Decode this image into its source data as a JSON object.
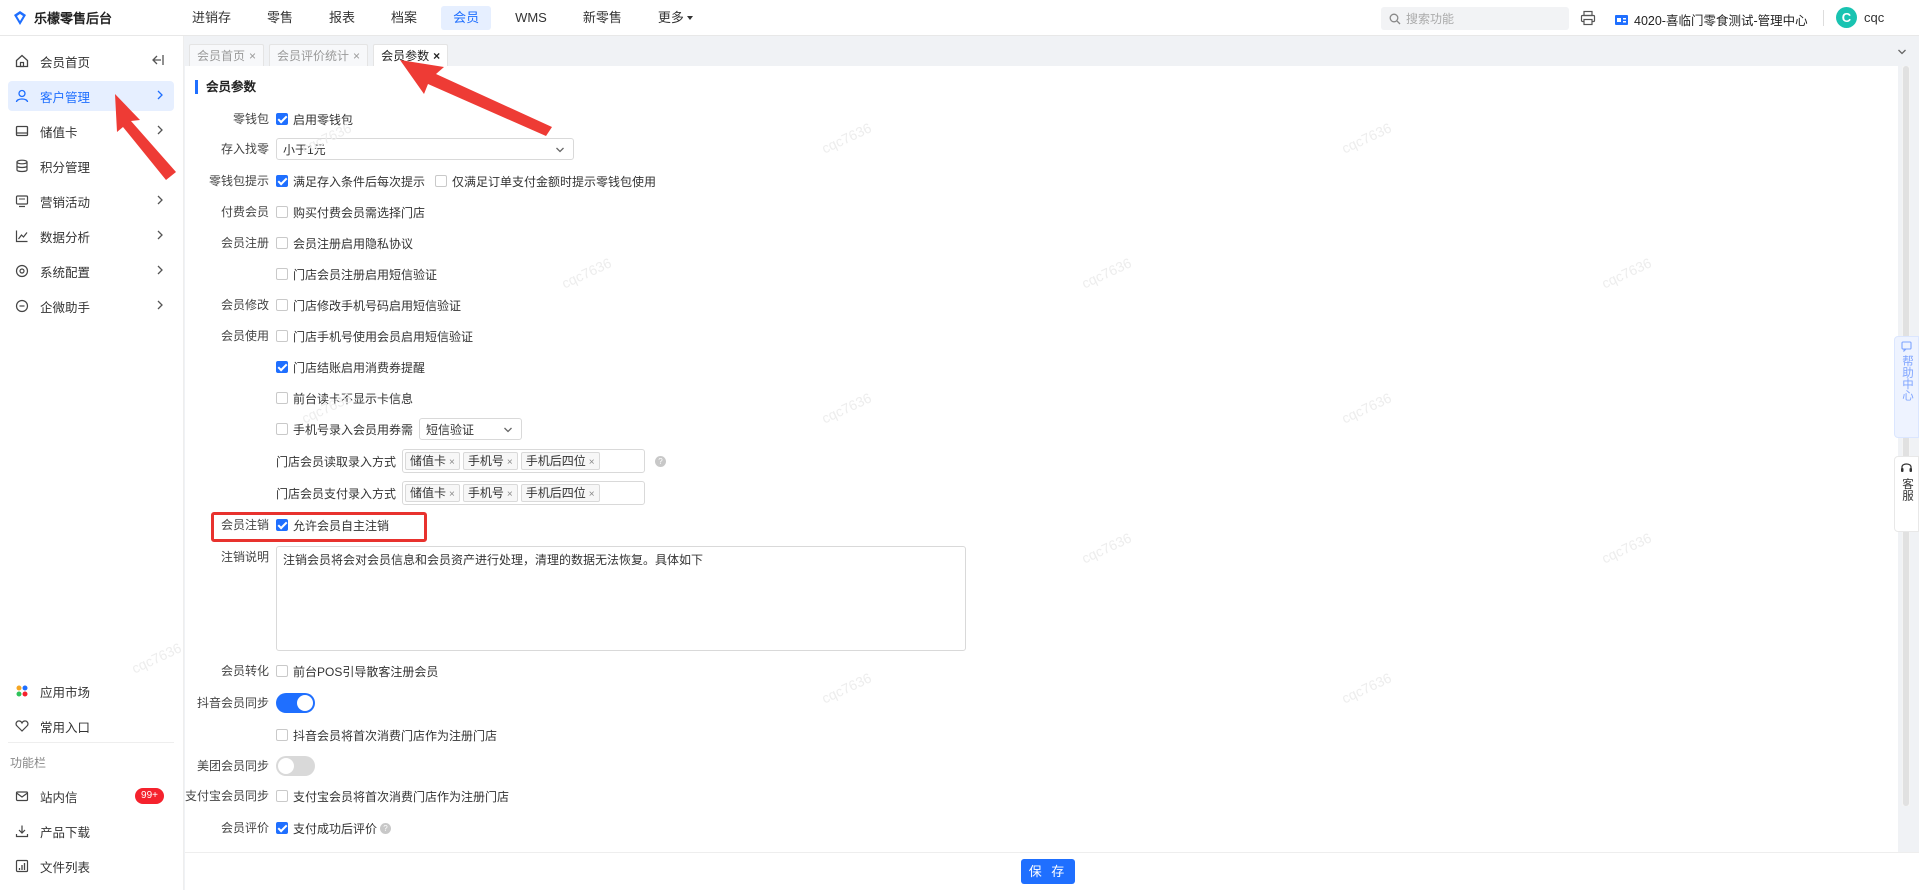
{
  "app": {
    "title": "乐檬零售后台"
  },
  "topnav": [
    "进销存",
    "零售",
    "报表",
    "档案",
    "会员",
    "WMS",
    "新零售",
    "更多"
  ],
  "topnav_active": "会员",
  "search": {
    "placeholder": "搜索功能"
  },
  "store": "4020-喜临门零食测试-管理中心",
  "user": {
    "avatar_letter": "C",
    "name": "cqc"
  },
  "sidebar": {
    "items": [
      {
        "label": "会员首页",
        "icon": "home-icon"
      },
      {
        "label": "客户管理",
        "icon": "user-icon"
      },
      {
        "label": "储值卡",
        "icon": "card-icon"
      },
      {
        "label": "积分管理",
        "icon": "database-icon"
      },
      {
        "label": "营销活动",
        "icon": "monitor-icon"
      },
      {
        "label": "数据分析",
        "icon": "chart-icon"
      },
      {
        "label": "系统配置",
        "icon": "settings-icon"
      },
      {
        "label": "企微助手",
        "icon": "chat-icon"
      }
    ],
    "bottom": [
      {
        "label": "应用市场",
        "icon": "apps-icon"
      },
      {
        "label": "常用入口",
        "icon": "heart-icon"
      }
    ],
    "section_label": "功能栏",
    "tools": [
      {
        "label": "站内信",
        "icon": "mail-icon",
        "badge": "99+"
      },
      {
        "label": "产品下载",
        "icon": "download-icon"
      },
      {
        "label": "文件列表",
        "icon": "file-list-icon"
      }
    ]
  },
  "tabs": [
    {
      "label": "会员首页"
    },
    {
      "label": "会员评价统计"
    },
    {
      "label": "会员参数"
    }
  ],
  "form": {
    "section_title": "会员参数",
    "wallet": {
      "label": "零钱包",
      "opt": "启用零钱包"
    },
    "deposit": {
      "label": "存入找零",
      "value": "小于1元"
    },
    "wallet_tip": {
      "label": "零钱包提示",
      "opt1": "满足存入条件后每次提示",
      "opt2": "仅满足订单支付金额时提示零钱包使用"
    },
    "paid_member": {
      "label": "付费会员",
      "opt": "购买付费会员需选择门店"
    },
    "register": {
      "label": "会员注册",
      "opt1": "会员注册启用隐私协议",
      "opt2": "门店会员注册启用短信验证"
    },
    "modify": {
      "label": "会员修改",
      "opt": "门店修改手机号码启用短信验证"
    },
    "usage": {
      "label": "会员使用",
      "opt1": "门店手机号使用会员启用短信验证",
      "opt2": "门店结账启用消费券提醒",
      "opt3": "前台读卡不显示卡信息",
      "opt4": "手机号录入会员用券需",
      "opt4_select": "短信验证"
    },
    "read_mode": {
      "label": "门店会员读取录入方式",
      "tags": [
        "储值卡",
        "手机号",
        "手机后四位"
      ]
    },
    "pay_mode": {
      "label": "门店会员支付录入方式",
      "tags": [
        "储值卡",
        "手机号",
        "手机后四位"
      ]
    },
    "cancel": {
      "label": "会员注销",
      "opt": "允许会员自主注销"
    },
    "cancel_desc": {
      "label": "注销说明",
      "text": "注销会员将会对会员信息和会员资产进行处理，清理的数据无法恢复。具体如下"
    },
    "convert": {
      "label": "会员转化",
      "opt": "前台POS引导散客注册会员"
    },
    "douyin": {
      "label": "抖音会员同步",
      "opt": "抖音会员将首次消费门店作为注册门店"
    },
    "meituan": {
      "label": "美团会员同步"
    },
    "alipay": {
      "label": "支付宝会员同步",
      "opt": "支付宝会员将首次消费门店作为注册门店"
    },
    "rating": {
      "label": "会员评价",
      "opt": "支付成功后评价"
    }
  },
  "save_label": "保 存",
  "float": {
    "help": "帮助中心",
    "kefu": "客服"
  },
  "watermark": "cqc7636",
  "colors": {
    "accent": "#1f6fff",
    "annotation": "#e8322e"
  }
}
